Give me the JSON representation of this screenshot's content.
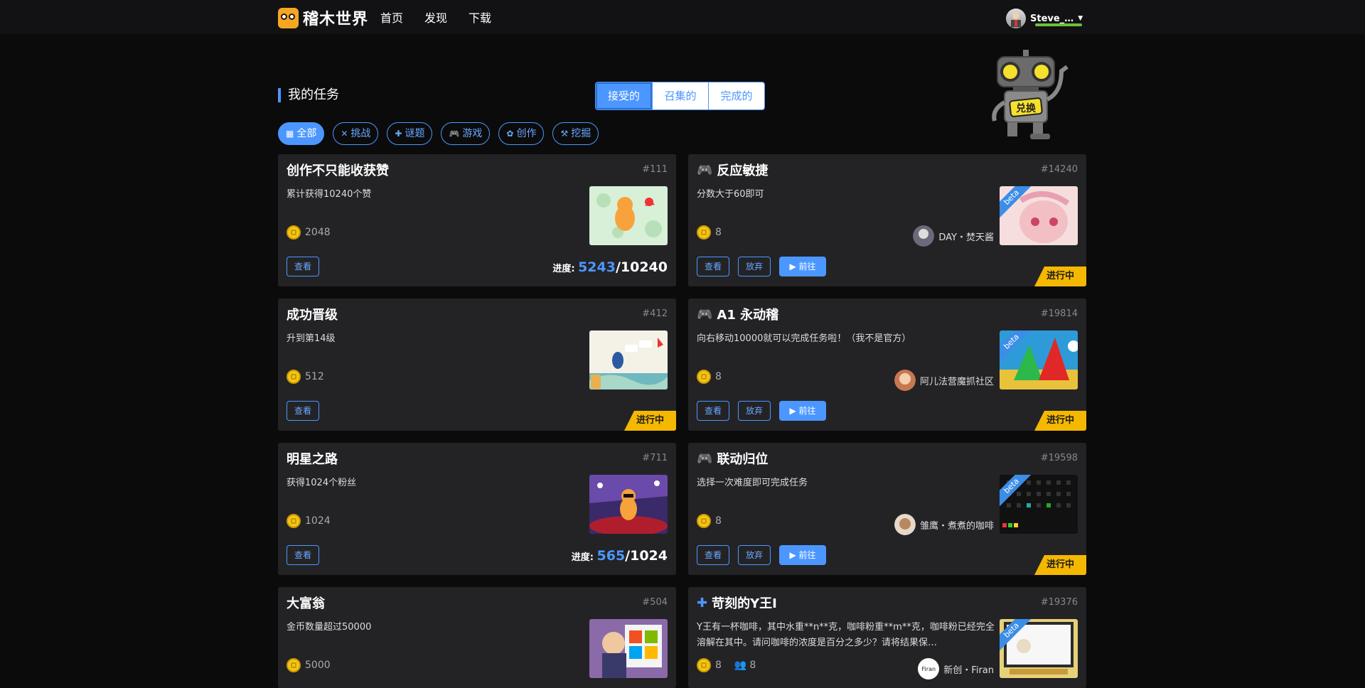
{
  "header": {
    "logo_text": "稽木世界",
    "nav": [
      "首页",
      "发现",
      "下载"
    ],
    "username": "Steve_…"
  },
  "page": {
    "title": "我的任务",
    "tabs": [
      "接受的",
      "召集的",
      "完成的"
    ],
    "active_tab": "接受的",
    "robot_badge": "兑换",
    "filters": [
      {
        "label": "全部",
        "icon": "grid-icon",
        "active": true
      },
      {
        "label": "挑战",
        "icon": "swords-icon"
      },
      {
        "label": "谜题",
        "icon": "puzzle-icon"
      },
      {
        "label": "游戏",
        "icon": "gamepad-icon"
      },
      {
        "label": "创作",
        "icon": "palette-icon"
      },
      {
        "label": "挖掘",
        "icon": "pickaxe-icon"
      }
    ]
  },
  "labels": {
    "view": "查看",
    "abandon": "放弃",
    "go": "前往",
    "progress": "进度:",
    "in_progress": "进行中",
    "beta": "beta"
  },
  "left_cards": [
    {
      "title": "创作不只能收获赞",
      "num": "#111",
      "desc": "累计获得10240个赞",
      "coins": "2048",
      "progress_cur": "5243",
      "progress_total": "/10240"
    },
    {
      "title": "成功晋级",
      "num": "#412",
      "desc": "升到第14级",
      "coins": "512"
    },
    {
      "title": "明星之路",
      "num": "#711",
      "desc": "获得1024个粉丝",
      "coins": "1024",
      "progress_cur": "565",
      "progress_total": "/1024"
    },
    {
      "title": "大富翁",
      "num": "#504",
      "desc": "金币数量超过50000",
      "coins": "5000"
    }
  ],
  "right_cards": [
    {
      "title": "反应敏捷",
      "num": "#14240",
      "desc": "分数大于60即可",
      "coins": "8",
      "author": "DAY・焚天酱",
      "icon": "gamepad-icon"
    },
    {
      "title": "A1 永动稽",
      "num": "#19814",
      "desc": "向右移动10000就可以完成任务啦！（我不是官方）",
      "coins": "8",
      "author": "阿儿法营魔抓社区",
      "icon": "gamepad-icon"
    },
    {
      "title": "联动归位",
      "num": "#19598",
      "desc": "选择一次难度即可完成任务",
      "coins": "8",
      "author": "雏鹰・煮煮的咖啡",
      "icon": "gamepad-icon"
    },
    {
      "title": "苛刻的Y王I",
      "num": "#19376",
      "desc": "Y王有一杯咖啡，其中水重**n**克，咖啡粉重**m**克，咖啡粉已经完全溶解在其中。请问咖啡的浓度是百分之多少？请将结果保…",
      "coins": "8",
      "extra_count": "8",
      "author": "新创・Firan",
      "author_avatar_text": "Firan",
      "icon": "puzzle-icon"
    }
  ]
}
